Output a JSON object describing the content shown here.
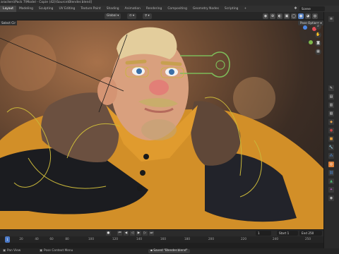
{
  "window": {
    "title": "aracters\\Pack 7\\Model - Copie (42)\\Source\\Blender.blend]"
  },
  "workspace_tabs": [
    "Layout",
    "Modeling",
    "Sculpting",
    "UV Editing",
    "Texture Paint",
    "Shading",
    "Animation",
    "Rendering",
    "Compositing",
    "Geometry Nodes",
    "Scripting",
    "+"
  ],
  "scene": {
    "label": "Scene"
  },
  "viewport_header": {
    "select_label": "Select Cir",
    "orientation_label": "Global",
    "pose_options_label": "Pose Options"
  },
  "timeline": {
    "current_frame": "1",
    "start_label": "Start",
    "start_value": "1",
    "end_label": "End",
    "end_value": "250",
    "ruler_ticks": [
      "20",
      "40",
      "60",
      "80",
      "100",
      "120",
      "140",
      "160",
      "180",
      "200",
      "220",
      "240",
      "250"
    ],
    "playhead_value": "1"
  },
  "status_bar": {
    "left_label": "Pan View",
    "context_menu_label": "Pose Context Menu",
    "toast": "Saved \"Blender.blend\""
  },
  "icons": {
    "scene": "scene-icon",
    "gizmo_move": "move-icon",
    "gizmo_hand": "hand-icon",
    "camera": "camera-icon",
    "grid": "grid-icon"
  },
  "colors": {
    "accent": "#4b79c7",
    "jacket": "#d9962a",
    "rig_line": "#c9b73a",
    "control_ring": "#7dbb5a"
  }
}
